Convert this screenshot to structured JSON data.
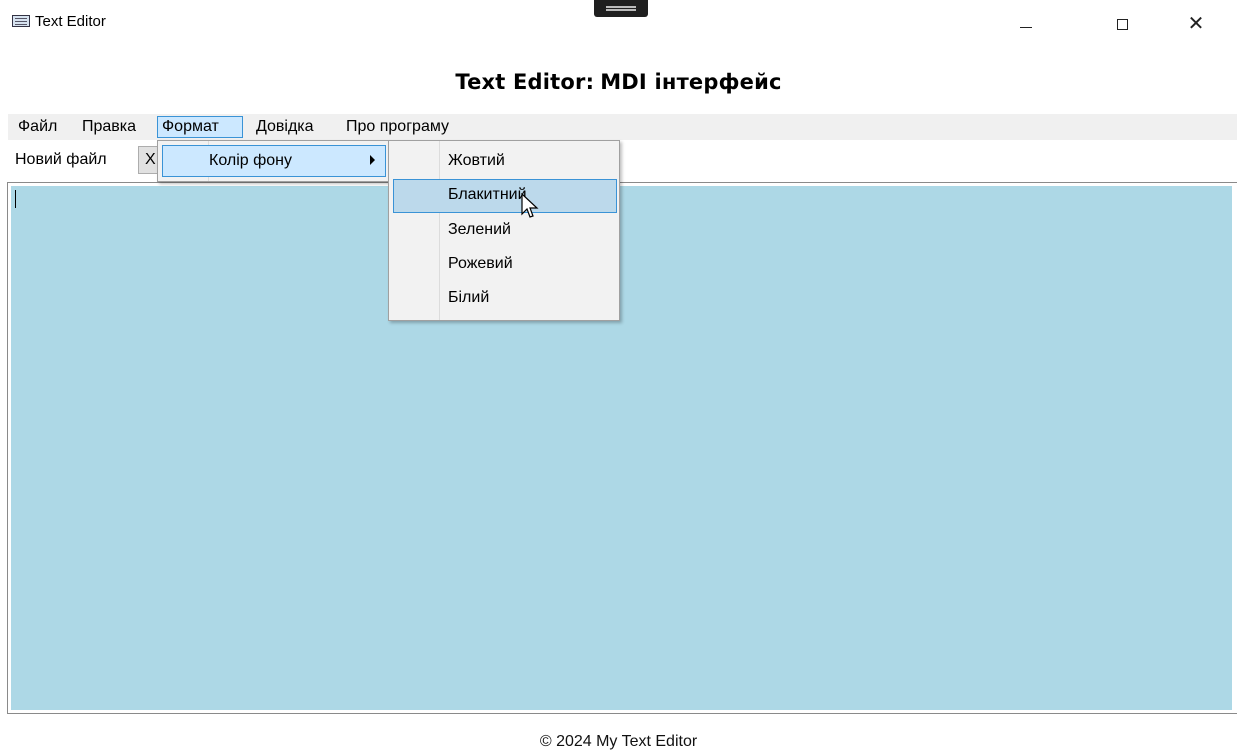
{
  "window": {
    "title": "Text Editor",
    "controls": {
      "minimize": "minimize-icon",
      "maximize": "maximize-icon",
      "close": "close-icon"
    }
  },
  "heading": {
    "prefix": "Text Editor:",
    "suffix": "MDI інтерфейс"
  },
  "menubar": {
    "items": [
      {
        "label": "Файл"
      },
      {
        "label": "Правка"
      },
      {
        "label": "Формат",
        "active": true
      },
      {
        "label": "Довідка"
      },
      {
        "label": "Про програму"
      }
    ]
  },
  "toolbar": {
    "new_file": "Новий файл",
    "second_button_visible_text": "Х"
  },
  "format_menu": {
    "items": [
      {
        "label": "Колір фону",
        "has_submenu": true
      }
    ]
  },
  "color_submenu": {
    "items": [
      {
        "label": "Жовтий"
      },
      {
        "label": "Блакитний",
        "hovered": true
      },
      {
        "label": "Зелений"
      },
      {
        "label": "Рожевий"
      },
      {
        "label": "Білий"
      }
    ]
  },
  "editor": {
    "background_color": "#add8e6",
    "content": ""
  },
  "colors": {
    "accent": "#3a93d6",
    "menu_hover": "#cce8ff",
    "menubar_bg": "#f0f0f0"
  },
  "footer": {
    "text": "© 2024 My Text Editor"
  }
}
